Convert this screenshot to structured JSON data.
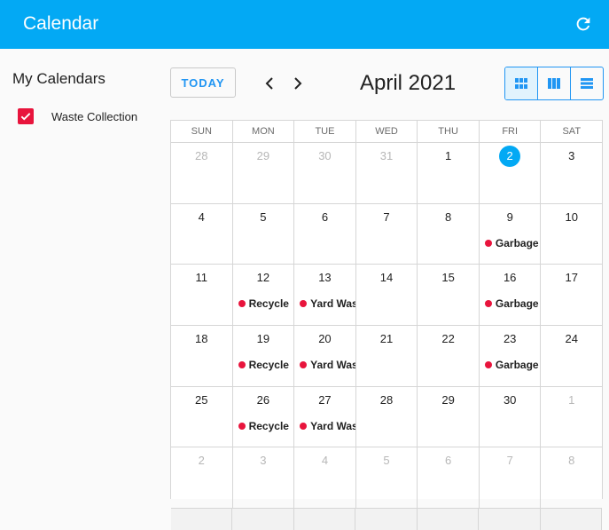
{
  "app": {
    "title": "Calendar"
  },
  "sidebar": {
    "heading": "My Calendars",
    "calendars": [
      {
        "label": "Waste Collection",
        "checked": true,
        "color": "#e8143c"
      }
    ]
  },
  "toolbar": {
    "today_label": "TODAY",
    "prev_icon": "chevron-left-icon",
    "next_icon": "chevron-right-icon",
    "month_title": "April 2021",
    "views": [
      {
        "icon": "month-grid-icon",
        "active": true
      },
      {
        "icon": "week-columns-icon",
        "active": false
      },
      {
        "icon": "list-rows-icon",
        "active": false
      }
    ]
  },
  "calendar": {
    "weekdays": [
      "SUN",
      "MON",
      "TUE",
      "WED",
      "THU",
      "FRI",
      "SAT"
    ],
    "weeks": [
      [
        {
          "day": "28",
          "other": true
        },
        {
          "day": "29",
          "other": true
        },
        {
          "day": "30",
          "other": true
        },
        {
          "day": "31",
          "other": true
        },
        {
          "day": "1"
        },
        {
          "day": "2",
          "today": true
        },
        {
          "day": "3"
        }
      ],
      [
        {
          "day": "4"
        },
        {
          "day": "5"
        },
        {
          "day": "6"
        },
        {
          "day": "7"
        },
        {
          "day": "8"
        },
        {
          "day": "9",
          "event": "Garbage"
        },
        {
          "day": "10"
        }
      ],
      [
        {
          "day": "11"
        },
        {
          "day": "12",
          "event": "Recycle"
        },
        {
          "day": "13",
          "event": "Yard Waste"
        },
        {
          "day": "14"
        },
        {
          "day": "15"
        },
        {
          "day": "16",
          "event": "Garbage"
        },
        {
          "day": "17"
        }
      ],
      [
        {
          "day": "18"
        },
        {
          "day": "19",
          "event": "Recycle"
        },
        {
          "day": "20",
          "event": "Yard Waste"
        },
        {
          "day": "21"
        },
        {
          "day": "22"
        },
        {
          "day": "23",
          "event": "Garbage"
        },
        {
          "day": "24"
        }
      ],
      [
        {
          "day": "25"
        },
        {
          "day": "26",
          "event": "Recycle"
        },
        {
          "day": "27",
          "event": "Yard Waste"
        },
        {
          "day": "28"
        },
        {
          "day": "29"
        },
        {
          "day": "30"
        },
        {
          "day": "1",
          "other": true
        }
      ],
      [
        {
          "day": "2",
          "other": true
        },
        {
          "day": "3",
          "other": true
        },
        {
          "day": "4",
          "other": true
        },
        {
          "day": "5",
          "other": true
        },
        {
          "day": "6",
          "other": true
        },
        {
          "day": "7",
          "other": true
        },
        {
          "day": "8",
          "other": true
        }
      ]
    ],
    "event_color": "#e8143c",
    "today_color": "#03a9f4"
  },
  "colors": {
    "appbar": "#03a9f4",
    "accent": "#2196f3"
  }
}
